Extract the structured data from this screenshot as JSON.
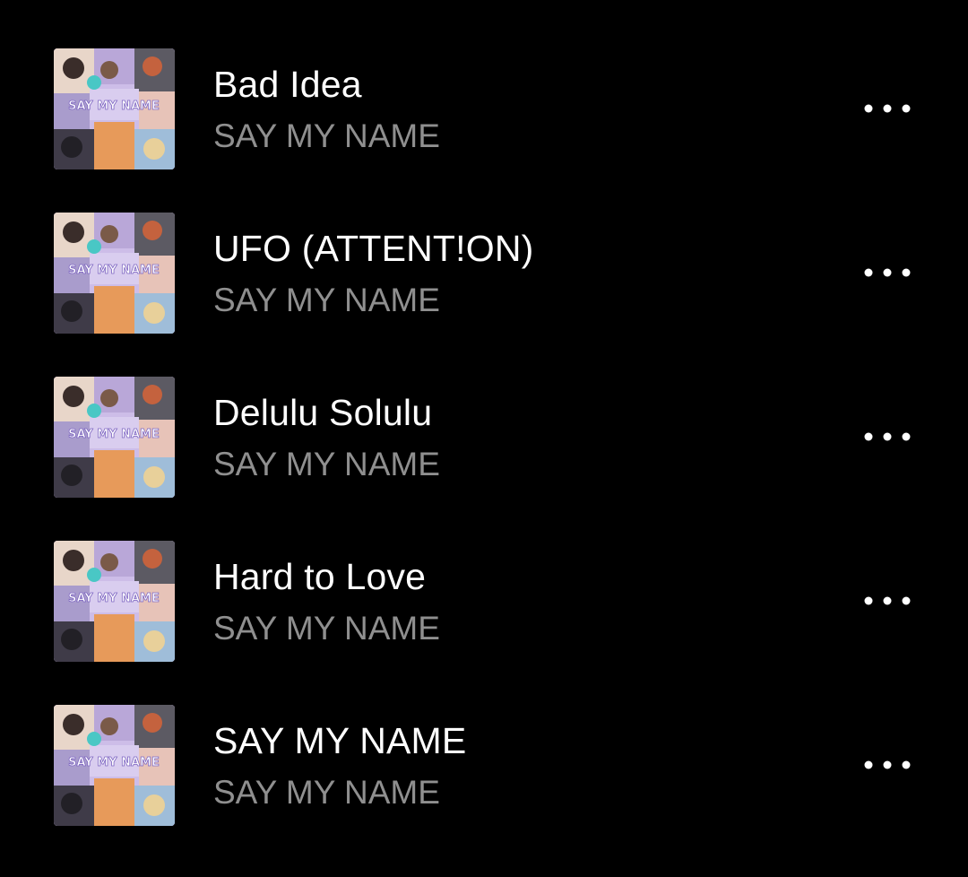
{
  "colors": {
    "background": "#000000",
    "title": "#ffffff",
    "subtitle": "#8f8f8f",
    "icon": "#ffffff"
  },
  "tracks": [
    {
      "title": "Bad Idea",
      "album": "SAY MY NAME",
      "more_icon": "more-horizontal-icon"
    },
    {
      "title": "UFO (ATTENT!ON)",
      "album": "SAY MY NAME",
      "more_icon": "more-horizontal-icon"
    },
    {
      "title": "Delulu Solulu",
      "album": "SAY MY NAME",
      "more_icon": "more-horizontal-icon"
    },
    {
      "title": "Hard to Love",
      "album": "SAY MY NAME",
      "more_icon": "more-horizontal-icon"
    },
    {
      "title": "SAY MY NAME",
      "album": "SAY MY NAME",
      "more_icon": "more-horizontal-icon"
    }
  ]
}
